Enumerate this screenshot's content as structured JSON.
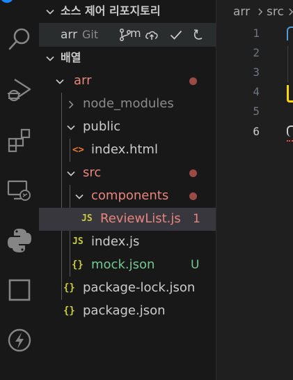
{
  "colors": {
    "modified": "#e8857d",
    "modified_dot": "#9b4b45",
    "untracked": "#73c991",
    "error_count": "#e8857d",
    "js_icon": "#cbcb41",
    "json_icon": "#cbcb41",
    "html_icon": "#e37933"
  },
  "activity_bar": {
    "icons": [
      "search-icon",
      "run-debug-icon",
      "extensions-icon",
      "remote-explorer-icon",
      "python-icon",
      "square-icon",
      "lightning-icon"
    ]
  },
  "scm": {
    "section_title": "소스 제어 리포지토리",
    "repo_name": "arr",
    "repo_type": "Git",
    "branch_label": "m"
  },
  "explorer": {
    "section_title": "배열",
    "tree": [
      {
        "name": "arr",
        "kind": "folder",
        "expanded": true,
        "status": "modified"
      },
      {
        "name": "node_modules",
        "kind": "folder",
        "expanded": false
      },
      {
        "name": "public",
        "kind": "folder",
        "expanded": true
      },
      {
        "name": "index.html",
        "kind": "file",
        "icon": "<>"
      },
      {
        "name": "src",
        "kind": "folder",
        "expanded": true,
        "status": "modified"
      },
      {
        "name": "components",
        "kind": "folder",
        "expanded": true,
        "status": "modified"
      },
      {
        "name": "ReviewList.js",
        "kind": "file",
        "icon": "JS",
        "badge": "1",
        "selected": true
      },
      {
        "name": "index.js",
        "kind": "file",
        "icon": "JS"
      },
      {
        "name": "mock.json",
        "kind": "file",
        "icon": "{}",
        "badge": "U"
      },
      {
        "name": "package-lock.json",
        "kind": "file",
        "icon": "{}"
      },
      {
        "name": "package.json",
        "kind": "file",
        "icon": "{}"
      }
    ]
  },
  "editor": {
    "breadcrumb": [
      "arr",
      "src"
    ],
    "line_numbers": [
      "1",
      "2",
      "3",
      "4",
      "5",
      "6"
    ],
    "active_line": "6"
  }
}
